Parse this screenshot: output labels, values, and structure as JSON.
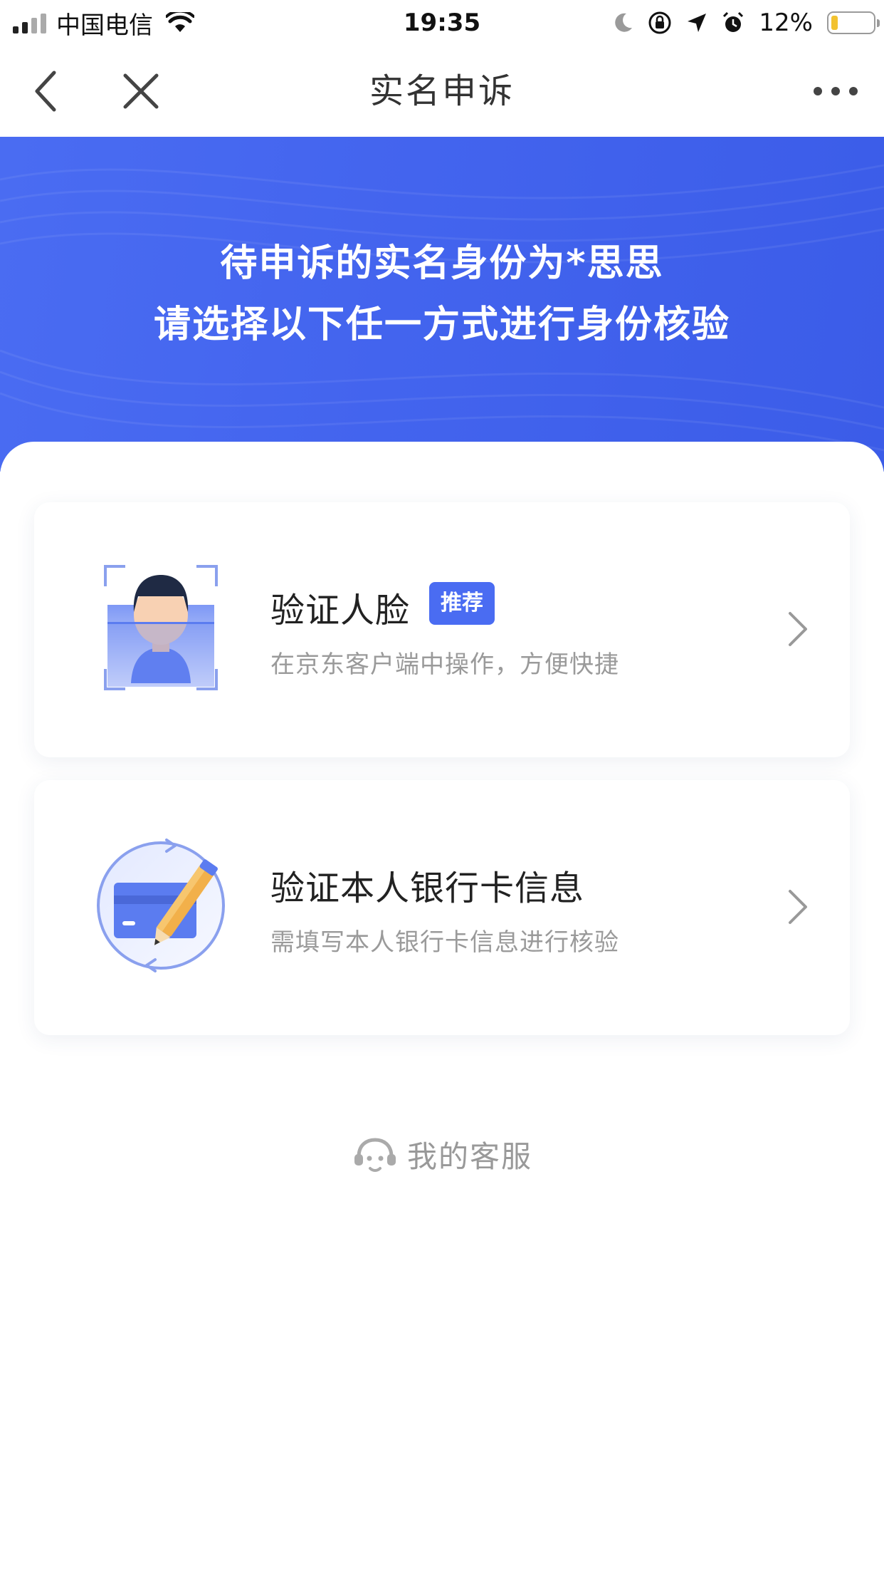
{
  "status_bar": {
    "carrier": "中国电信",
    "time": "19:35",
    "battery_percent": "12%",
    "battery_level": 0.12
  },
  "nav": {
    "title": "实名申诉"
  },
  "banner": {
    "line1": "待申诉的实名身份为*思思",
    "line2": "请选择以下任一方式进行身份核验"
  },
  "options": [
    {
      "title": "验证人脸",
      "badge": "推荐",
      "description": "在京东客户端中操作，方便快捷",
      "icon": "face-verify-icon"
    },
    {
      "title": "验证本人银行卡信息",
      "description": "需填写本人银行卡信息进行核验",
      "icon": "bank-card-icon"
    }
  ],
  "service": {
    "label": "我的客服",
    "icon": "customer-service-icon"
  },
  "colors": {
    "accent": "#4a6cf2",
    "banner": "#4364ee",
    "muted_text": "#9a9a9a"
  }
}
